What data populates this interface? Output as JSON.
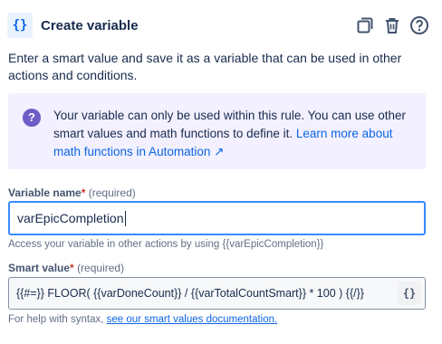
{
  "header": {
    "icon_text": "{}",
    "title": "Create variable",
    "actions": [
      "copy-icon",
      "trash-icon",
      "help-icon"
    ]
  },
  "description": "Enter a smart value and save it as a variable that can be used in other actions and conditions.",
  "info_panel": {
    "text": "Your variable can only be used within this rule. You can use other smart values and math functions to define it. ",
    "link_text": "Learn more about math functions in Automation ↗"
  },
  "variable_name": {
    "label": "Variable name",
    "required_marker": "*",
    "required_text": "(required)",
    "value": "varEpicCompletion",
    "help": "Access your variable in other actions by using {{varEpicCompletion}}"
  },
  "smart_value": {
    "label": "Smart value",
    "required_marker": "*",
    "required_text": "(required)",
    "value": "{{#=}} FLOOR( {{varDoneCount}} / {{varTotalCountSmart}} * 100 ) {{/}}",
    "button_text": "{}",
    "help_prefix": "For help with syntax, ",
    "help_link": "see our smart values documentation."
  },
  "colors": {
    "accent": "#0c66e4",
    "focus_border": "#388bff",
    "info_bg": "#f3f0ff",
    "info_icon": "#6e5dc6",
    "required": "#c9372c"
  }
}
